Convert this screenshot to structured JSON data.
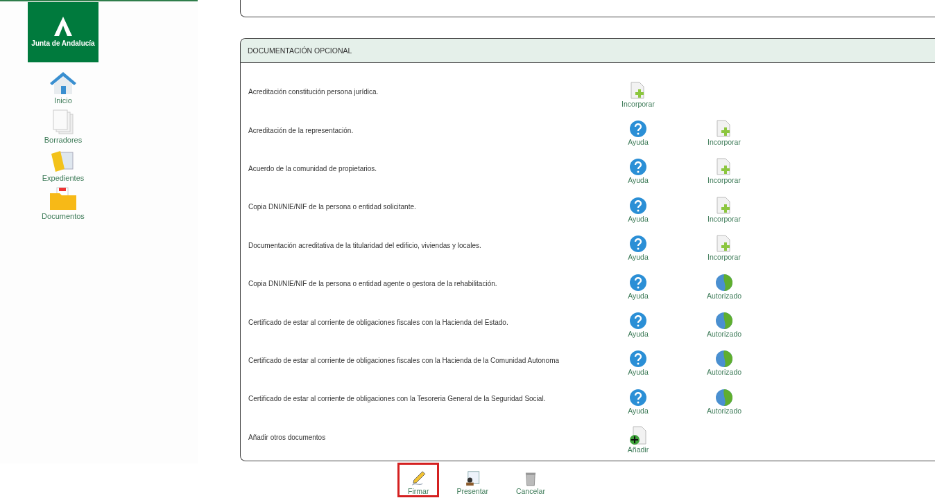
{
  "logo": {
    "text": "Junta de Andalucía"
  },
  "sidebar": {
    "items": [
      {
        "kind": "home",
        "label": "Inicio"
      },
      {
        "kind": "drafts",
        "label": "Borradores"
      },
      {
        "kind": "folder",
        "label": "Expedientes"
      },
      {
        "kind": "documents",
        "label": "Documentos"
      }
    ]
  },
  "panel": {
    "title": "DOCUMENTACIÓN OPCIONAL",
    "rows": [
      {
        "label": "Acreditación constitución persona jurídica.",
        "actions": [
          {
            "kind": "add",
            "label": "Incorporar"
          }
        ]
      },
      {
        "label": "Acreditación de la representación.",
        "actions": [
          {
            "kind": "help",
            "label": "Ayuda"
          },
          {
            "kind": "add",
            "label": "Incorporar"
          }
        ]
      },
      {
        "label": "Acuerdo de la comunidad de propietarios.",
        "actions": [
          {
            "kind": "help",
            "label": "Ayuda"
          },
          {
            "kind": "add",
            "label": "Incorporar"
          }
        ]
      },
      {
        "label": "Copia DNI/NIE/NIF de la persona o entidad solicitante.",
        "actions": [
          {
            "kind": "help",
            "label": "Ayuda"
          },
          {
            "kind": "add",
            "label": "Incorporar"
          }
        ]
      },
      {
        "label": "Documentación acreditativa de la titularidad del edificio, viviendas y locales.",
        "actions": [
          {
            "kind": "help",
            "label": "Ayuda"
          },
          {
            "kind": "add",
            "label": "Incorporar"
          }
        ]
      },
      {
        "label": "Copia DNI/NIE/NIF de la persona o entidad agente o gestora de la rehabilitación.",
        "actions": [
          {
            "kind": "help",
            "label": "Ayuda"
          },
          {
            "kind": "authorized",
            "label": "Autorizado"
          }
        ]
      },
      {
        "label": "Certificado de estar al corriente de obligaciones fiscales con la Hacienda del Estado.",
        "actions": [
          {
            "kind": "help",
            "label": "Ayuda"
          },
          {
            "kind": "authorized",
            "label": "Autorizado"
          }
        ]
      },
      {
        "label": "Certificado de estar al corriente de obligaciones fiscales con la Hacienda de la Comunidad Autonoma",
        "actions": [
          {
            "kind": "help",
            "label": "Ayuda"
          },
          {
            "kind": "authorized",
            "label": "Autorizado"
          }
        ]
      },
      {
        "label": "Certificado de estar al corriente de obligaciones con la Tesoreria General de la Seguridad Social.",
        "actions": [
          {
            "kind": "help",
            "label": "Ayuda"
          },
          {
            "kind": "authorized",
            "label": "Autorizado"
          }
        ]
      },
      {
        "label": "Añadir otros documentos",
        "actions": [
          {
            "kind": "append",
            "label": "Añadir"
          }
        ]
      }
    ]
  },
  "buttons": [
    {
      "kind": "sign",
      "label": "Firmar",
      "selected": true
    },
    {
      "kind": "submit",
      "label": "Presentar",
      "selected": false
    },
    {
      "kind": "cancel",
      "label": "Cancelar",
      "selected": false
    }
  ]
}
